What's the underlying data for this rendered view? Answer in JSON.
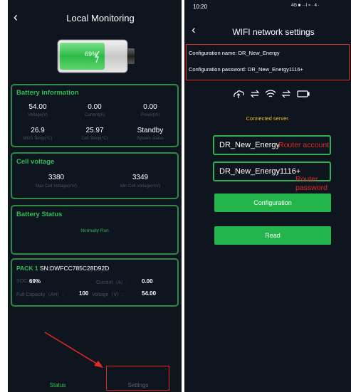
{
  "left": {
    "back_icon": "chevron-left-icon",
    "title": "Local Monitoring",
    "battery": {
      "percent_label": "69%",
      "level": 0.69
    },
    "battery_info": {
      "heading": "Battery information",
      "row1": [
        {
          "value": "54.00",
          "label": "Voltage(V)"
        },
        {
          "value": "0.00",
          "label": "Current(A)"
        },
        {
          "value": "0.00",
          "label": "Power(W)"
        }
      ],
      "row2": [
        {
          "value": "26.9",
          "label": "MOS Temp(°C)"
        },
        {
          "value": "25.97",
          "label": "Cell Temp(°C)"
        },
        {
          "value": "Standby",
          "label": "System status"
        }
      ]
    },
    "cell_voltage": {
      "heading": "Cell voltage",
      "items": [
        {
          "value": "3380",
          "label": "Max Cell Voltage(mV)"
        },
        {
          "value": "3349",
          "label": "Min Cell Voltage(mV)"
        }
      ]
    },
    "battery_status": {
      "heading": "Battery Status",
      "value": "Normally Run"
    },
    "pack": {
      "name": "PACK 1",
      "sn": "SN:DWFCC785C28D92D",
      "soc_label": "SOC:",
      "soc_value": "69%",
      "current_label": "Current（A）:",
      "current_value": "0.00",
      "capacity_label": "Full Capacity（AH）:",
      "capacity_value": "100",
      "voltage_label": "Voltage（V）:",
      "voltage_value": "54.00"
    },
    "nav": {
      "status": "Status",
      "settings": "Settings"
    },
    "colors": {
      "accent": "#2fbd58",
      "annotation": "#e22a24"
    }
  },
  "right": {
    "status_bar": {
      "time": "10:20",
      "icons_text": "4G ■ ···l ≈ · 4 ·"
    },
    "back_icon": "chevron-left-icon",
    "title": "WIFI network settings",
    "config_name_label": "Configuration name:",
    "config_name_value": "DR_New_Energy",
    "config_password_label": "Configuration password:",
    "config_password_value": "DR_New_Energy1116+",
    "connection_icons": [
      "cloud-upload-icon",
      "exchange-icon",
      "wifi-icon",
      "exchange-icon",
      "battery-icon"
    ],
    "connected_text": "Connected server.",
    "router_account_value": "DR_New_Energy",
    "router_password_value": "DR_New_Energy1116+",
    "annotation_account": "Router account",
    "annotation_password": "Router password",
    "configuration_button": "Configuration",
    "read_button": "Read"
  }
}
